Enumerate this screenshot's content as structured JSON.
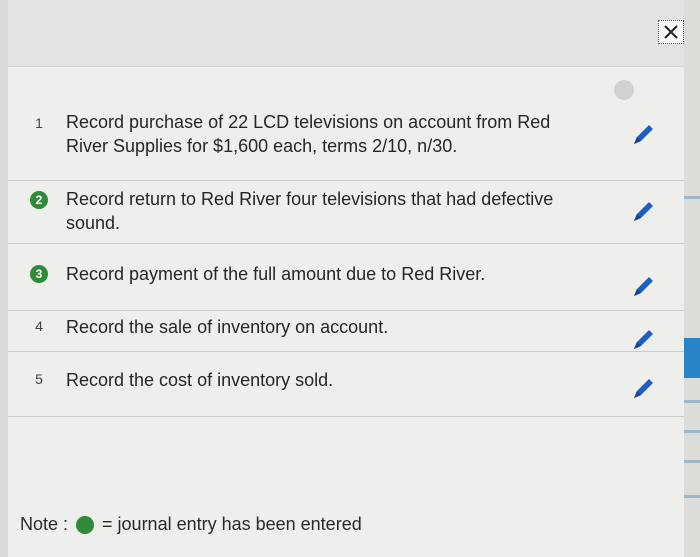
{
  "tasks": [
    {
      "number": "1",
      "text": "Record purchase of 22 LCD televisions on account from Red River Supplies for $1,600 each, terms 2/10, n/30.",
      "entered": false
    },
    {
      "number": "2",
      "text": "Record return to Red River four televisions that had defective sound.",
      "entered": true
    },
    {
      "number": "3",
      "text": "Record payment of the full amount due to Red River.",
      "entered": true
    },
    {
      "number": "4",
      "text": "Record the sale of inventory on account.",
      "entered": false
    },
    {
      "number": "5",
      "text": "Record the cost of inventory sold.",
      "entered": false
    }
  ],
  "note": {
    "label": "Note :",
    "text": "= journal entry has been entered"
  },
  "icons": {
    "close": "close-icon",
    "edit": "pencil-icon",
    "status": "entered-status-dot"
  },
  "colors": {
    "entered_green": "#2f8a3a",
    "edit_blue": "#1f5fbf"
  }
}
